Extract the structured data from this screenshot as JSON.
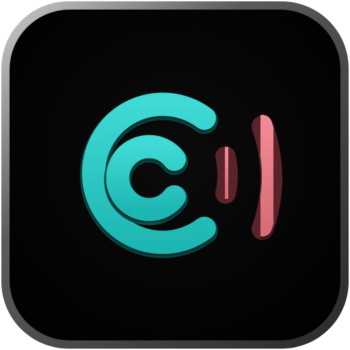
{
  "app_icon": {
    "name": "app-icon",
    "colors": {
      "frame_outer": "#9a9a9a",
      "frame_inner": "#3a3a3a",
      "background": "#050505",
      "teal": "#2cc8c4",
      "teal_shadow": "#0d5f5c",
      "pink": "#e77b86",
      "pink_shadow": "#6b2b33"
    },
    "icon_parts": [
      "outer-c-arc",
      "inner-c-arc",
      "short-signal-bar",
      "tall-signal-arc"
    ]
  }
}
